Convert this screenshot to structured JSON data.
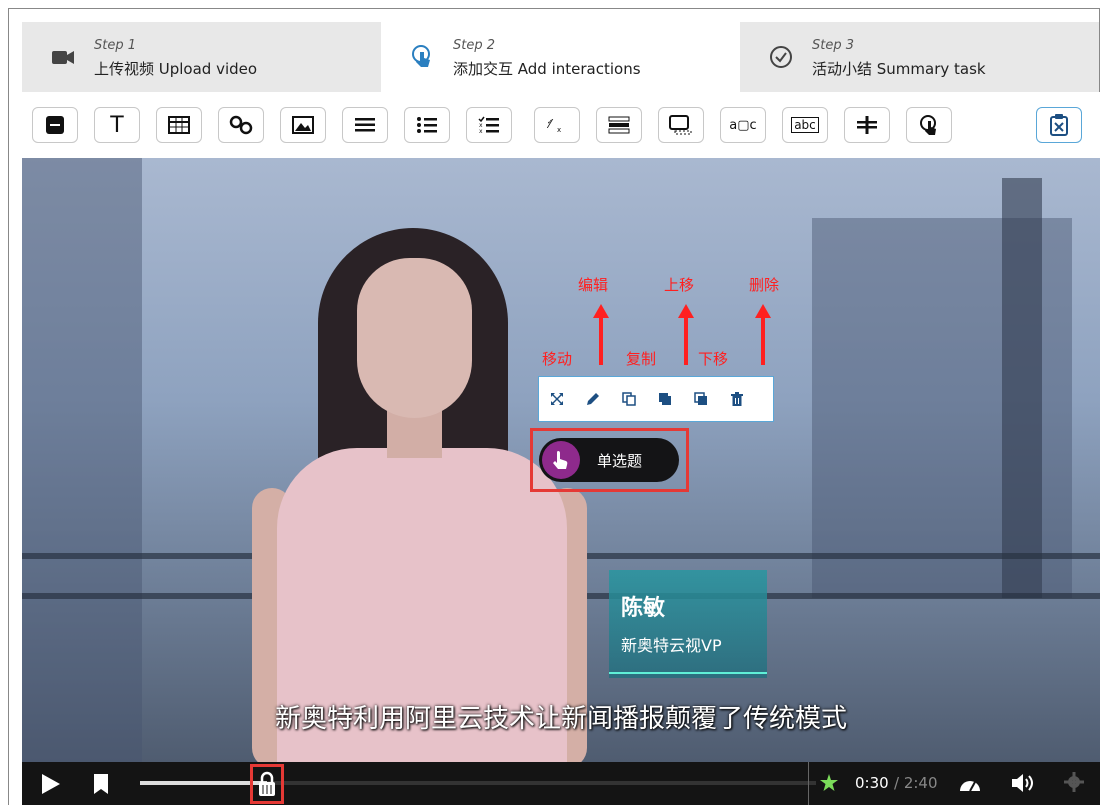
{
  "steps": [
    {
      "step": "Step 1",
      "label": "上传视频 Upload video",
      "icon": "video-camera-icon"
    },
    {
      "step": "Step 2",
      "label": "添加交互 Add interactions",
      "icon": "touch-icon"
    },
    {
      "step": "Step 3",
      "label": "活动小结 Summary task",
      "icon": "check-circle-icon"
    }
  ],
  "toolbar": {
    "text_tool": "T",
    "fill_blank_tool": "abc",
    "drag_text_tool": "a▢c",
    "icons": [
      "label-icon",
      "text-icon",
      "table-icon",
      "link-icon",
      "image-icon",
      "list-icon",
      "bullet-list-icon",
      "checklist-icon",
      "fraction-icon",
      "sort-icon",
      "resize-box-icon",
      "drag-text-icon",
      "fill-blank-icon",
      "divider-icon",
      "hotspot-icon",
      "clipboard-icon"
    ]
  },
  "annotations": {
    "edit": "编辑",
    "move_up": "上移",
    "delete": "删除",
    "move": "移动",
    "copy": "复制",
    "move_down": "下移"
  },
  "interaction": {
    "label": "单选题"
  },
  "video": {
    "name": "陈敏",
    "role": "新奥特云视VP",
    "subtitle": "新奥特利用阿里云技术让新闻播报颠覆了传统模式"
  },
  "player": {
    "current_time": "0:30",
    "total_time": "/ 2:40",
    "progress": 0.188
  },
  "colors": {
    "annotation_red": "#ff2020",
    "hotspot_purple": "#8e2a8c",
    "context_border": "#5aa7d8",
    "nameplate_teal": "#2896a0"
  }
}
